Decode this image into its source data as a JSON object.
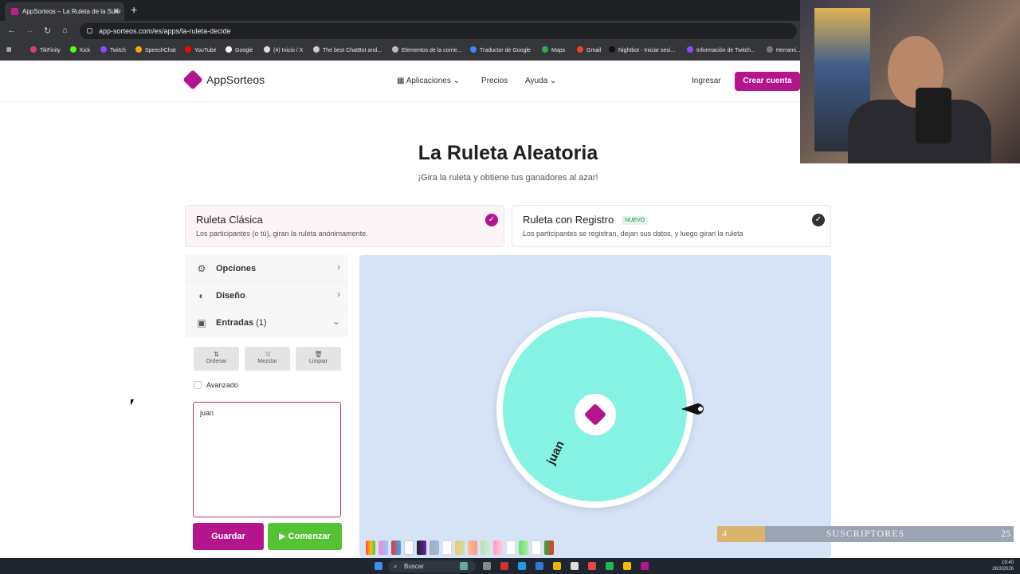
{
  "browser": {
    "tab_title": "AppSorteos – La Ruleta de la Suer",
    "url": "app-sorteos.com/es/apps/la-ruleta-decide",
    "bookmarks": [
      "TikFinity",
      "Kick",
      "Twitch",
      "SpeechChat",
      "YouTube",
      "Google",
      "(4) Inicio / X",
      "The best ChatBot and...",
      "Elementos de la corrie...",
      "Traductor de Google",
      "Maps",
      "Gmail",
      "Nightbot - Iniciar sesi...",
      "Información de Twitch...",
      "Herrami..."
    ]
  },
  "site": {
    "brand": "AppSorteos",
    "nav": {
      "aplicaciones": "Aplicaciones",
      "precios": "Precios",
      "ayuda": "Ayuda",
      "ingresar": "Ingresar",
      "crear": "Crear cuenta"
    }
  },
  "main": {
    "title": "La Ruleta Aleatoria",
    "subtitle": "¡Gira la ruleta y obtiene tus ganadores al azar!",
    "modes": [
      {
        "title": "Ruleta Clásica",
        "desc": "Los participantes (o tú), giran la ruleta anónimamente."
      },
      {
        "title": "Ruleta con Registro",
        "badge": "NUEVO",
        "desc": "Los participantes se registran, dejan sus datos, y luego giran la ruleta"
      }
    ],
    "sidebar": {
      "opciones": "Opciones",
      "diseno": "Diseño",
      "entradas": "Entradas",
      "entradas_count": "(1)"
    },
    "tools": {
      "ordenar": "Ordenar",
      "mezclar": "Mezclar",
      "limpiar": "Limpiar"
    },
    "avanzado": "Avanzado",
    "entries_text": "juan",
    "guardar": "Guardar",
    "comenzar": "Comenzar",
    "wheel_entry": "juan"
  },
  "overlay": {
    "subs_current": "4",
    "subs_label": "SUSCRIPTORES",
    "subs_goal": "25",
    "subs_fraction": 0.16
  },
  "taskbar": {
    "search": "Buscar",
    "time": "19:40",
    "date": "26/3/2026"
  },
  "colors": {
    "brand": "#b4148c",
    "wheel": "#86f2e3",
    "start": "#55c236"
  }
}
